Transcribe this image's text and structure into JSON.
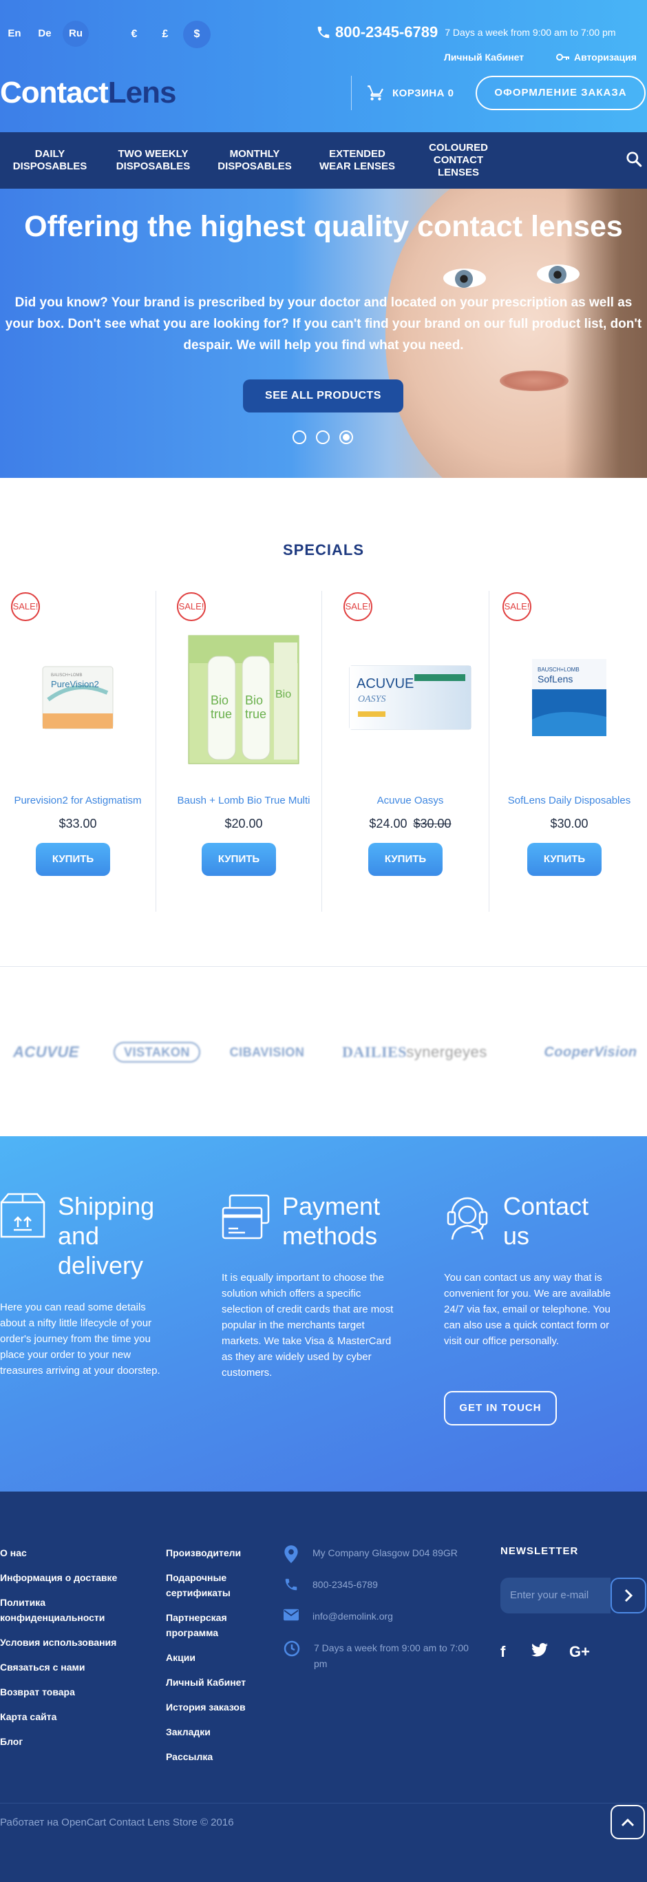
{
  "header": {
    "languages": [
      "En",
      "De",
      "Ru"
    ],
    "currencies": [
      "€",
      "£",
      "$"
    ],
    "phone": "800-2345-6789",
    "hours": "7 Days a week from 9:00 am to 7:00 pm",
    "account_label": "Личный Кабинет",
    "login_label": "Авторизация",
    "logo_part1": "Contact",
    "logo_part2": "Lens",
    "cart_label": "КОРЗИНА 0",
    "checkout_label": "ОФОРМЛЕНИЕ ЗАКАЗА"
  },
  "nav": {
    "items": [
      "DAILY DISPOSABLES",
      "TWO WEEKLY DISPOSABLES",
      "MONTHLY DISPOSABLES",
      "EXTENDED WEAR LENSES",
      "COLOURED CONTACT LENSES"
    ]
  },
  "hero": {
    "title": "Offering the highest quality contact lenses",
    "text": "Did you know? Your brand is prescribed by your doctor and located on your prescription as well as your box. Don't see what you are looking for? If you can't find your brand on our full product list, don't despair. We will help you find what you need.",
    "button": "SEE ALL PRODUCTS",
    "active_slide": 3
  },
  "specials": {
    "title": "SPECIALS",
    "sale_badge": "SALE!",
    "buy_label": "КУПИТЬ",
    "products": [
      {
        "name": "Purevision2 for Astigmatism",
        "price": "$33.00",
        "old_price": ""
      },
      {
        "name": "Baush + Lomb Bio True Multi",
        "price": "$20.00",
        "old_price": ""
      },
      {
        "name": "Acuvue Oasys",
        "price": "$24.00",
        "old_price": "$30.00"
      },
      {
        "name": "SofLens Daily Disposables",
        "price": "$30.00",
        "old_price": ""
      }
    ]
  },
  "brands": [
    "ACUVUE",
    "VISTAKON",
    "CIBAVISION",
    "DAILIES",
    "synergeyes",
    "CooperVision"
  ],
  "info": {
    "shipping": {
      "title": "Shipping and delivery",
      "text": "Here you can read some details about a nifty little lifecycle of your order's journey from the time you place your order to your new treasures arriving at your doorstep."
    },
    "payment": {
      "title": "Payment methods",
      "text": "It is equally important to choose the solution which offers a specific selection of credit cards that are most popular in the merchants target markets. We take Visa & MasterCard as they are widely used by cyber customers."
    },
    "contact": {
      "title": "Contact us",
      "text": "You can contact us any way that is convenient for you. We are available 24/7 via fax, email or telephone. You can also use a quick contact form or visit our office personally.",
      "button": "GET IN TOUCH"
    }
  },
  "footer": {
    "col1": [
      "О нас",
      "Информация о доставке",
      "Политика конфиденциальности",
      "Условия использования",
      "Связаться с нами",
      "Возврат товара",
      "Карта сайта",
      "Блог"
    ],
    "col2": [
      "Производители",
      "Подарочные сертификаты",
      "Партнерская программа",
      "Акции",
      "Личный Кабинет",
      "История заказов",
      "Закладки",
      "Рассылка"
    ],
    "address": "My Company Glasgow D04 89GR",
    "phone": "800-2345-6789",
    "email": "info@demolink.org",
    "hours": "7 Days a week from 9:00 am to 7:00 pm",
    "newsletter_title": "NEWSLETTER",
    "newsletter_placeholder": "Enter your e-mail",
    "social": [
      "f",
      "t",
      "G+"
    ],
    "copyright": "Работает на OpenCart Contact Lens Store © 2016"
  },
  "colors": {
    "accent": "#3d8ce8",
    "nav": "#1c3a78",
    "sale": "#e04040"
  }
}
